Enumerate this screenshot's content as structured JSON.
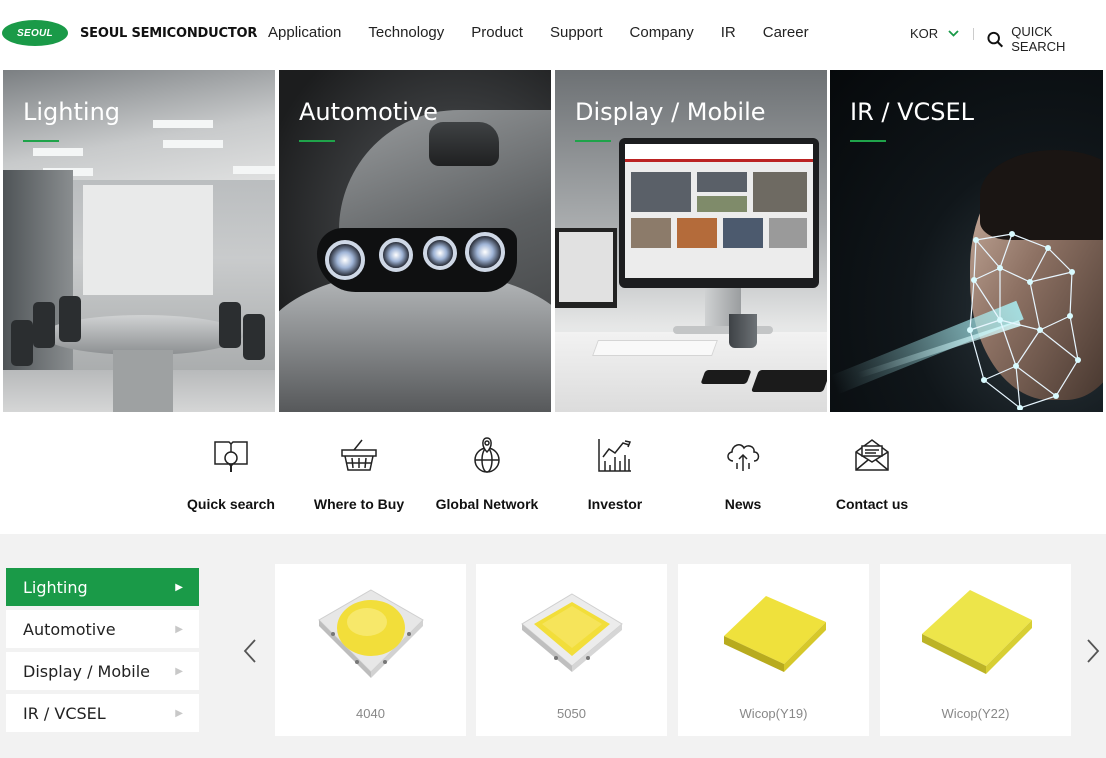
{
  "header": {
    "logo_badge": "SEOUL",
    "logo_text": "SEOUL SEMICONDUCTOR",
    "nav": [
      "Application",
      "Technology",
      "Product",
      "Support",
      "Company",
      "IR",
      "Career"
    ],
    "language": "KOR",
    "quick_search": "QUICK SEARCH"
  },
  "tiles": [
    {
      "title": "Lighting"
    },
    {
      "title": "Automotive"
    },
    {
      "title": "Display / Mobile"
    },
    {
      "title": "IR / VCSEL"
    }
  ],
  "quick_links": [
    {
      "label": "Quick search",
      "icon": "book-magnifier-icon"
    },
    {
      "label": "Where to Buy",
      "icon": "basket-icon"
    },
    {
      "label": "Global Network",
      "icon": "globe-pin-icon"
    },
    {
      "label": "Investor",
      "icon": "chart-icon"
    },
    {
      "label": "News",
      "icon": "cloud-icon"
    },
    {
      "label": "Contact us",
      "icon": "envelope-icon"
    }
  ],
  "product_menu": [
    {
      "label": "Lighting",
      "active": true
    },
    {
      "label": "Automotive",
      "active": false
    },
    {
      "label": "Display / Mobile",
      "active": false
    },
    {
      "label": "IR / VCSEL",
      "active": false
    }
  ],
  "products": [
    {
      "name": "4040"
    },
    {
      "name": "5050"
    },
    {
      "name": "Wicop(Y19)"
    },
    {
      "name": "Wicop(Y22)"
    }
  ],
  "colors": {
    "brand_green": "#1a9a48",
    "accent_green": "#1fa34a",
    "led_yellow": "#f2de3a"
  }
}
